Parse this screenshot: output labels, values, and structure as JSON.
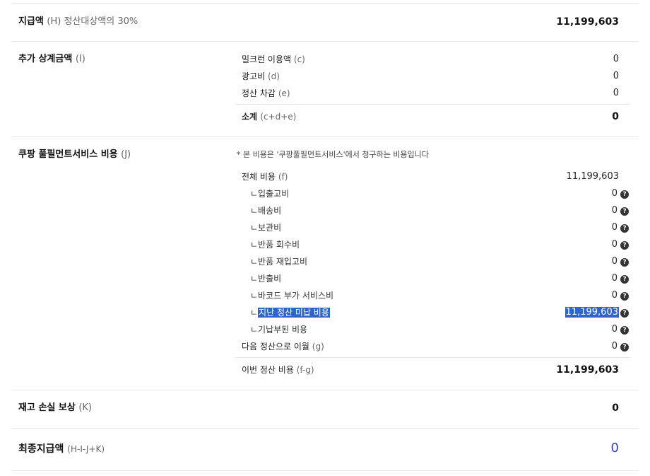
{
  "payment_h": {
    "label": "지급액",
    "paren": "(H) 정산대상액의 30%",
    "value": "11,199,603"
  },
  "extra_i": {
    "label": "추가 상계금액",
    "paren": "(I)",
    "items": [
      {
        "label": "밀크런 이용액",
        "paren": "(c)",
        "value": "0"
      },
      {
        "label": "광고비",
        "paren": "(d)",
        "value": "0"
      },
      {
        "label": "정산 차감",
        "paren": "(e)",
        "value": "0"
      }
    ],
    "subtotal": {
      "label": "소계",
      "paren": "(c+d+e)",
      "value": "0"
    }
  },
  "fulfillment_j": {
    "label": "쿠팡 풀필먼트서비스 비용",
    "paren": "(J)",
    "note": "* 본 비용은 '쿠팡풀필먼트서비스'에서 청구하는 비용입니다",
    "total": {
      "label": "전체 비용",
      "paren": "(f)",
      "value": "11,199,603"
    },
    "breakdown": [
      {
        "label": "ㄴ입출고비",
        "value": "0"
      },
      {
        "label": "ㄴ배송비",
        "value": "0"
      },
      {
        "label": "ㄴ보관비",
        "value": "0"
      },
      {
        "label": "ㄴ반품 회수비",
        "value": "0"
      },
      {
        "label": "ㄴ반품 재입고비",
        "value": "0"
      },
      {
        "label": "ㄴ반출비",
        "value": "0"
      },
      {
        "label": "ㄴ바코드 부가 서비스비",
        "value": "0"
      },
      {
        "label_prefix": "ㄴ",
        "label": "지난 정산 미납 비용",
        "value": "11,199,603",
        "selected": true
      },
      {
        "label": "ㄴ기납부된 비용",
        "value": "0"
      }
    ],
    "carryover": {
      "label": "다음 정산으로 이월",
      "paren": "(g)",
      "value": "0"
    },
    "this_period": {
      "label": "이번 정산 비용",
      "paren": "(f-g)",
      "value": "11,199,603"
    }
  },
  "inventory_k": {
    "label": "재고 손실 보상",
    "paren": "(K)",
    "value": "0"
  },
  "final": {
    "label": "최종지급액",
    "paren": "(H-I-J+K)",
    "value": "0"
  },
  "help_icon_glyph": "?",
  "colors": {
    "final_value": "#2e3fb5",
    "selection": "#2f64c8"
  }
}
